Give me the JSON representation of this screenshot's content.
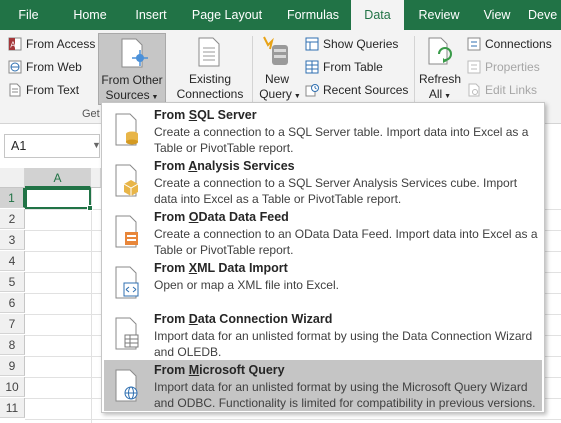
{
  "tabs": [
    {
      "label": "File",
      "active": false
    },
    {
      "label": "Home",
      "active": false
    },
    {
      "label": "Insert",
      "active": false
    },
    {
      "label": "Page Layout",
      "active": false
    },
    {
      "label": "Formulas",
      "active": false
    },
    {
      "label": "Data",
      "active": true
    },
    {
      "label": "Review",
      "active": false
    },
    {
      "label": "View",
      "active": false
    },
    {
      "label": "Deve",
      "active": false
    }
  ],
  "ribbon": {
    "get_external": {
      "from_access": "From Access",
      "from_web": "From Web",
      "from_text": "From Text",
      "from_other_line1": "From Other",
      "from_other_line2": "Sources",
      "existing_line1": "Existing",
      "existing_line2": "Connections",
      "group_label_partial": "Get"
    },
    "get_transform": {
      "new_query_line1": "New",
      "new_query_line2": "Query",
      "show_queries": "Show Queries",
      "from_table": "From Table",
      "recent_sources": "Recent Sources"
    },
    "connections": {
      "refresh_line1": "Refresh",
      "refresh_line2": "All",
      "connections": "Connections",
      "properties": "Properties",
      "edit_links": "Edit Links"
    }
  },
  "name_box": "A1",
  "grid": {
    "columns": [
      "A"
    ],
    "rows": [
      "1",
      "2",
      "3",
      "4",
      "5",
      "6",
      "7",
      "8",
      "9",
      "10",
      "11"
    ],
    "selected_cell": "A1"
  },
  "menu": {
    "items": [
      {
        "prefix": "From ",
        "underline": "S",
        "suffix": "QL Server",
        "desc": "Create a connection to a SQL Server table. Import data into Excel as a Table or PivotTable report.",
        "highlighted": false
      },
      {
        "prefix": "From ",
        "underline": "A",
        "suffix": "nalysis Services",
        "desc": "Create a connection to a SQL Server Analysis Services cube. Import data into Excel as a Table or PivotTable report.",
        "highlighted": false
      },
      {
        "prefix": "From ",
        "underline": "O",
        "suffix": "Data Data Feed",
        "desc": "Create a connection to an OData Data Feed. Import data into Excel as a Table or PivotTable report.",
        "highlighted": false
      },
      {
        "prefix": "From ",
        "underline": "X",
        "suffix": "ML Data Import",
        "desc": "Open or map a XML file into Excel.",
        "highlighted": false
      },
      {
        "prefix": "From ",
        "underline": "D",
        "suffix": "ata Connection Wizard",
        "desc": "Import data for an unlisted format by using the Data Connection Wizard and OLEDB.",
        "highlighted": false
      },
      {
        "prefix": "From ",
        "underline": "M",
        "suffix": "icrosoft Query",
        "desc": "Import data for an unlisted format by using the Microsoft Query Wizard and ODBC. Functionality is limited for compatibility in previous versions.",
        "highlighted": true
      }
    ]
  },
  "colors": {
    "excel_green": "#217346",
    "ribbon_bg": "#f3f3f3",
    "menu_highlight": "#c5c5c5"
  }
}
